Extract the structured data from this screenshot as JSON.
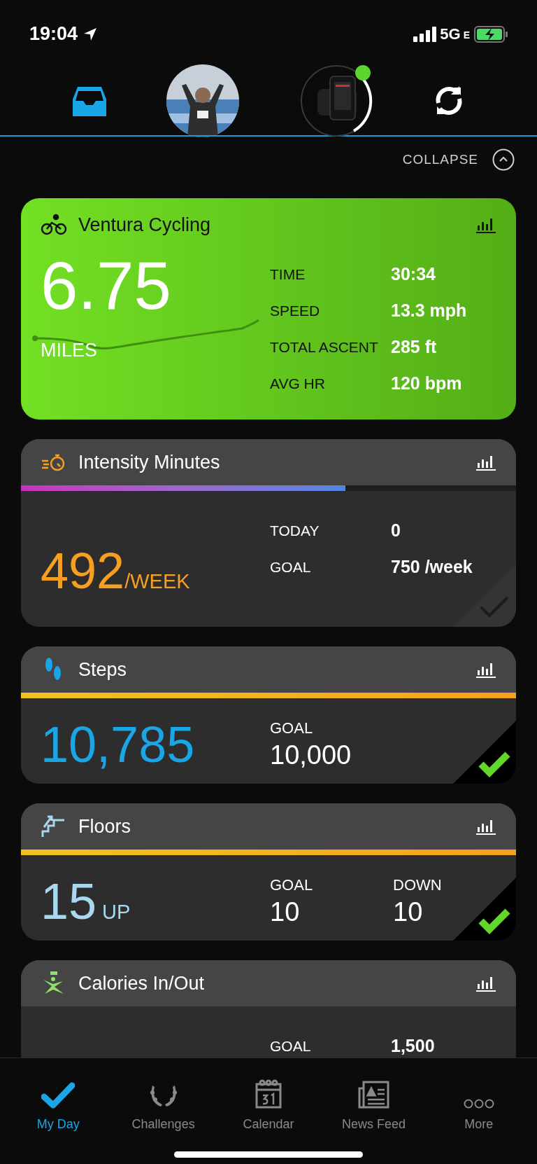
{
  "status_bar": {
    "time": "19:04",
    "network": "5G",
    "network_suffix": "E"
  },
  "header": {
    "inbox_selected": true,
    "device_connected": true
  },
  "collapse_label": "COLLAPSE",
  "cards": [
    {
      "kind": "activity",
      "title": "Ventura Cycling",
      "value": "6.75",
      "unit": "MILES",
      "stats": [
        {
          "label": "TIME",
          "value": "30:34"
        },
        {
          "label": "SPEED",
          "value": "13.3 mph"
        },
        {
          "label": "TOTAL ASCENT",
          "value": "285 ft"
        },
        {
          "label": "AVG HR",
          "value": "120 bpm"
        }
      ]
    },
    {
      "kind": "intensity",
      "title": "Intensity Minutes",
      "level": 0.655,
      "value": "492",
      "unit": "/WEEK",
      "goal_met": false,
      "stats": [
        {
          "label": "TODAY",
          "value": "0"
        },
        {
          "label": "GOAL",
          "value": "750 /week"
        }
      ]
    },
    {
      "kind": "steps",
      "title": "Steps",
      "level": 1,
      "value": "10,785",
      "goal_met": true,
      "stats": [
        {
          "label": "GOAL",
          "value": "10,000"
        }
      ]
    },
    {
      "kind": "floors",
      "title": "Floors",
      "level": 1,
      "value": "15",
      "unit": "UP",
      "goal_met": true,
      "stats": [
        {
          "label": "GOAL",
          "value": "10"
        },
        {
          "label": "DOWN",
          "value": "10"
        }
      ]
    },
    {
      "kind": "calories",
      "title": "Calories In/Out",
      "stats": [
        {
          "label": "GOAL",
          "value": "1,500"
        }
      ]
    }
  ],
  "tab_bar": [
    {
      "kind": "myday",
      "label": "My Day",
      "selected": true
    },
    {
      "kind": "challenges",
      "label": "Challenges",
      "selected": false
    },
    {
      "kind": "calendar",
      "label": "Calendar",
      "selected": false
    },
    {
      "kind": "news",
      "label": "News Feed",
      "selected": false
    },
    {
      "kind": "more",
      "label": "More",
      "selected": false
    }
  ]
}
